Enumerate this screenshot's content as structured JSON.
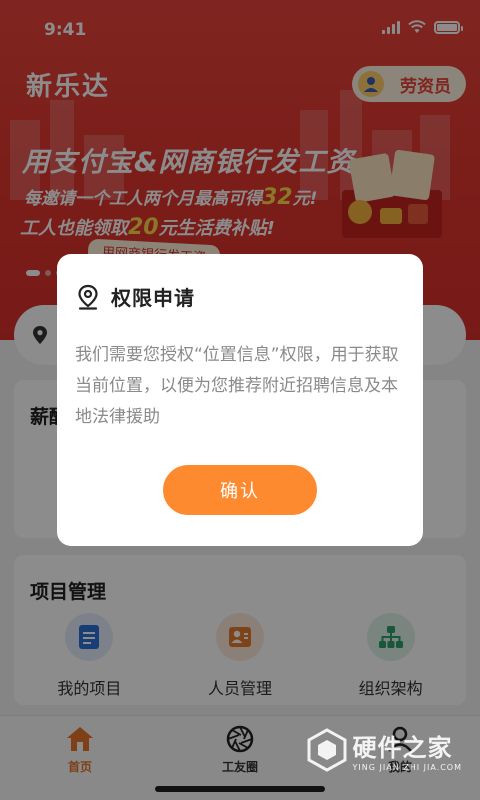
{
  "status_bar": {
    "time": "9:41"
  },
  "header": {
    "app_title": "新乐达",
    "role_label": "劳资员"
  },
  "banner": {
    "headline": "用支付宝&网商银行发工资",
    "line1_prefix": "每邀请一个工人两个月最高可得",
    "line1_amount": "32",
    "line1_suffix": "元!",
    "line2_prefix": "工人也能领取",
    "line2_amount": "20",
    "line2_suffix": "元生活费补贴!",
    "tag": "用网商银行发工资"
  },
  "sections": {
    "salary_title": "薪酬",
    "projects_title": "项目管理",
    "project_items": [
      {
        "label": "我的项目",
        "icon": "document-icon",
        "color": "#2f6fd6"
      },
      {
        "label": "人员管理",
        "icon": "person-card-icon",
        "color": "#e67a2e"
      },
      {
        "label": "组织架构",
        "icon": "org-chart-icon",
        "color": "#2e9e6a"
      }
    ]
  },
  "tabbar": {
    "tabs": [
      {
        "label": "首页",
        "icon": "home-icon"
      },
      {
        "label": "工友圈",
        "icon": "aperture-icon"
      },
      {
        "label": "我的",
        "icon": "user-icon"
      }
    ]
  },
  "watermark": {
    "text": "硬件之家",
    "sub": "YING JIAN ZHI JIA.COM"
  },
  "dialog": {
    "title": "权限申请",
    "body": "我们需要您授权“位置信息”权限，用于获取当前位置，以便为您推荐附近招聘信息及本地法律援助",
    "confirm_label": "确认"
  },
  "colors": {
    "brand_red": "#e8443b",
    "accent_orange": "#fe8a30"
  }
}
